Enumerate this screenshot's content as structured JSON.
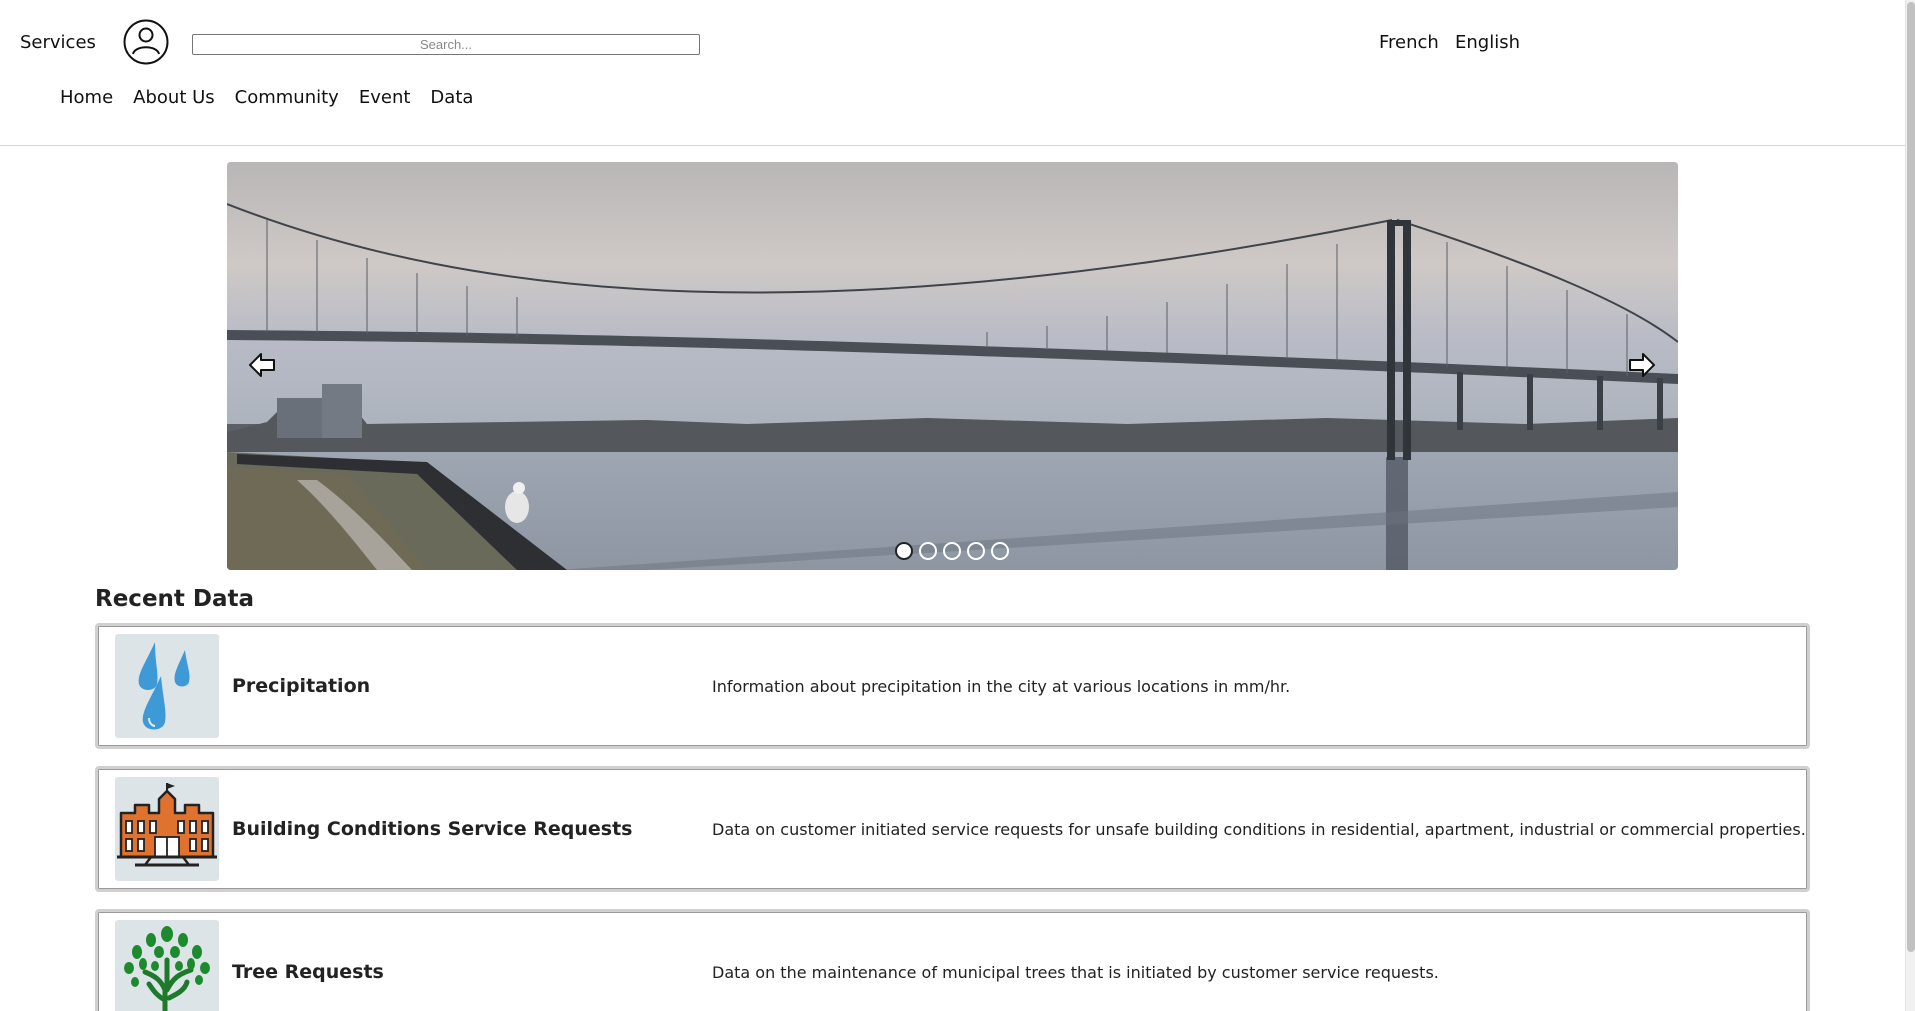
{
  "header": {
    "services_label": "Services",
    "search": {
      "placeholder": "Search...",
      "value": ""
    },
    "languages": [
      "French",
      "English"
    ]
  },
  "nav": {
    "items": [
      "Home",
      "About Us",
      "Community",
      "Event",
      "Data"
    ]
  },
  "carousel": {
    "slide_count": 5,
    "active_index": 0,
    "image_description_icon": "bridge-photo"
  },
  "recent": {
    "title": "Recent Data",
    "items": [
      {
        "name": "Precipitation",
        "description": "Information about precipitation in the city at various locations in mm/hr.",
        "icon": "raindrops-icon"
      },
      {
        "name": "Building Conditions Service Requests",
        "description": "Data on customer initiated service requests for unsafe building conditions in residential, apartment, industrial or commercial properties.",
        "icon": "building-icon"
      },
      {
        "name": "Tree Requests",
        "description": "Data on the maintenance of municipal trees that is initiated by customer service requests.",
        "icon": "tree-icon"
      }
    ]
  },
  "colors": {
    "card_border": "#d0d0d0",
    "thumb_bg": "#dce4e8",
    "raindrop": "#3d9ad6",
    "building": "#e0722f",
    "tree": "#1e8a2e"
  }
}
